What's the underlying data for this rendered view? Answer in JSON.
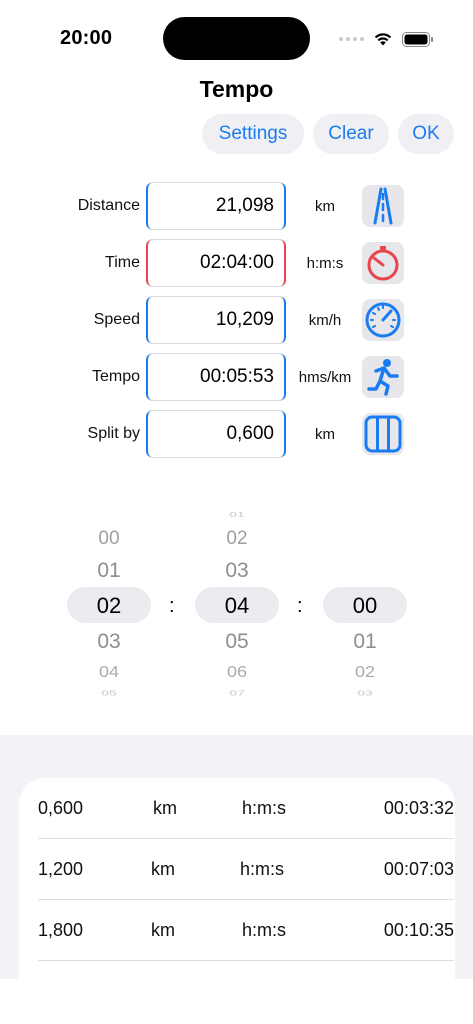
{
  "status_bar": {
    "time": "20:00"
  },
  "header": {
    "title": "Tempo"
  },
  "toolbar": {
    "settings_label": "Settings",
    "clear_label": "Clear",
    "ok_label": "OK"
  },
  "accent_color": "#1a7cf3",
  "error_color": "#e8454c",
  "form": {
    "rows": [
      {
        "label": "Distance",
        "value": "21,098",
        "unit": "km",
        "icon": "road-icon",
        "state": "normal"
      },
      {
        "label": "Time",
        "value": "02:04:00",
        "unit": "h:m:s",
        "icon": "stopwatch-icon",
        "state": "error"
      },
      {
        "label": "Speed",
        "value": "10,209",
        "unit": "km/h",
        "icon": "speedometer-icon",
        "state": "normal"
      },
      {
        "label": "Tempo",
        "value": "00:05:53",
        "unit": "hms/km",
        "icon": "runner-icon",
        "state": "normal"
      },
      {
        "label": "Split by",
        "value": "0,600",
        "unit": "km",
        "icon": "columns-icon",
        "state": "normal"
      }
    ]
  },
  "time_picker": {
    "hours": {
      "above": [
        "00",
        "01"
      ],
      "selected": "02",
      "below": [
        "03",
        "04",
        "05"
      ]
    },
    "minutes": {
      "above": [
        "01",
        "02",
        "03"
      ],
      "selected": "04",
      "below": [
        "05",
        "06",
        "07"
      ]
    },
    "seconds": {
      "above": [],
      "selected": "00",
      "below": [
        "01",
        "02",
        "03"
      ]
    },
    "separator": ":"
  },
  "splits": [
    {
      "distance": "0,600",
      "unit": "km",
      "format": "h:m:s",
      "time": "00:03:32"
    },
    {
      "distance": "1,200",
      "unit": "km",
      "format": "h:m:s",
      "time": "00:07:03"
    },
    {
      "distance": "1,800",
      "unit": "km",
      "format": "h:m:s",
      "time": "00:10:35"
    }
  ]
}
